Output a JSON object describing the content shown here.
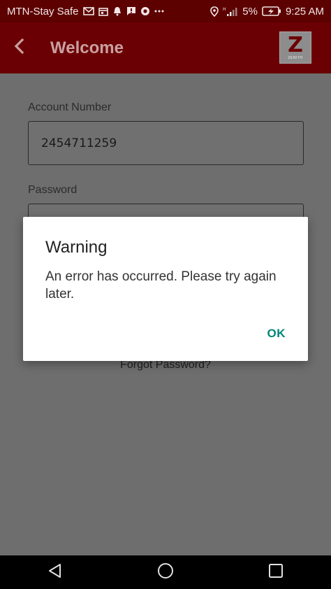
{
  "status_bar": {
    "carrier": "MTN-Stay Safe",
    "battery": "5%",
    "time": "9:25 AM",
    "icons": [
      "mail-icon",
      "calendar-icon",
      "bell-icon",
      "chat-icon",
      "chrome-icon",
      "more-icon",
      "location-icon",
      "signal-icon",
      "battery-icon"
    ]
  },
  "app_bar": {
    "title": "Welcome",
    "logo_text": "ZENITH",
    "background": "#6b0004"
  },
  "form": {
    "account_label": "Account Number",
    "account_value": "2454711259",
    "password_label": "Password",
    "password_value": "",
    "forgot_link": "Forgot Password?"
  },
  "dialog": {
    "title": "Warning",
    "message": "An error has occurred. Please try again later.",
    "ok_label": "OK",
    "accent": "#008577"
  }
}
